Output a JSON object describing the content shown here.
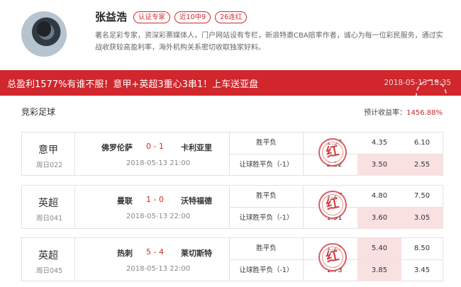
{
  "profile": {
    "name": "张益浩",
    "tags": [
      "认证专家",
      "近10中9",
      "26连红"
    ],
    "bio": "著名足彩专家，资深彩票媒体人，门户网站设有专栏，新浪特邀CBA赔率作者，诚心为每一位彩民服务，通过实战收获较高盈利率，海外机构关系密切收取独家好料。"
  },
  "banner": {
    "title": "总盈利1577%有谁不服！意甲+英超3重心3串1！上车送亚盘",
    "date": "2018-05-13 18:35"
  },
  "section": {
    "title": "竞彩足球",
    "expected_label": "预计收益率：",
    "expected_value": "1456.88%"
  },
  "stamp_text": "红",
  "colors": {
    "accent": "#d0262c",
    "hit_bg": "#f9e1e2"
  },
  "matches": [
    {
      "league": "意甲",
      "number": "周日022",
      "home": "佛罗伦萨",
      "score": "0 - 1",
      "away": "卡利亚里",
      "time": "2018-05-13 21:00",
      "rows": [
        {
          "play": "胜平负",
          "odds": [
            "1.36",
            "4.35",
            "6.10"
          ],
          "hit": []
        },
        {
          "play": "让球胜平负（-1）",
          "odds": [
            "2.22",
            "3.50",
            "2.55"
          ],
          "hit": [
            1,
            2
          ]
        }
      ]
    },
    {
      "league": "英超",
      "number": "周日041",
      "home": "曼联",
      "score": "1 - 0",
      "away": "沃特福德",
      "time": "2018-05-13 22:00",
      "rows": [
        {
          "play": "胜平负",
          "odds": [
            "1.27",
            "4.80",
            "7.50"
          ],
          "hit": []
        },
        {
          "play": "让球胜平负（-1）",
          "odds": [
            "1.91",
            "3.60",
            "3.05"
          ],
          "hit": [
            1,
            2
          ]
        }
      ]
    },
    {
      "league": "英超",
      "number": "周日045",
      "home": "热刺",
      "score": "5 - 4",
      "away": "莱切斯特",
      "time": "2018-05-13 22:00",
      "rows": [
        {
          "play": "胜平负",
          "odds": [
            "1.21",
            "5.40",
            "8.50"
          ],
          "hit": [
            1
          ]
        },
        {
          "play": "让球胜平负（-1）",
          "odds": [
            "1.73",
            "3.85",
            "3.45"
          ],
          "hit": [
            1
          ]
        }
      ]
    }
  ]
}
